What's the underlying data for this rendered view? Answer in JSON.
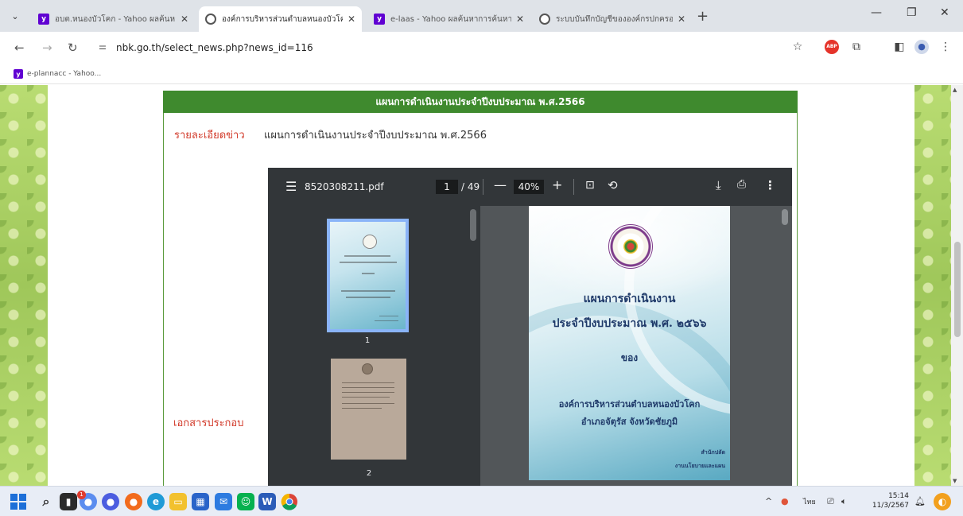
{
  "browser": {
    "tabs": [
      {
        "title": "อบต.หนองบัวโคก - Yahoo ผลค้นหา",
        "favicon": "yahoo-icon",
        "active": false
      },
      {
        "title": "องค์การบริหารส่วนตำบลหนองบัวโคก",
        "favicon": "globe-icon",
        "active": true
      },
      {
        "title": "e-laas - Yahoo ผลค้นหาการค้นหา",
        "favicon": "yahoo-icon",
        "active": false
      },
      {
        "title": "ระบบบันทึกบัญชีขององค์กรปกครอง",
        "favicon": "globe-icon",
        "active": false
      }
    ],
    "close_glyph": "✕",
    "new_tab_glyph": "+",
    "url": "nbk.go.th/select_news.php?news_id=116",
    "bookmark": "e-plannacc - Yahoo...",
    "accent": "#1a73e8"
  },
  "page": {
    "header_title": "แผนการดำเนินงานประจำปีงบประมาณ พ.ศ.2566",
    "detail_label": "รายละเอียดข่าว",
    "detail_value": "แผนการดำเนินงานประจำปีงบประมาณ พ.ศ.2566",
    "attachment_label": "เอกสารประกอบ",
    "header_color": "#3f8a2e",
    "label_color": "#d23b2b"
  },
  "pdf": {
    "filename": "8520308211.pdf",
    "current_page": "1",
    "total_pages": "/ 49",
    "zoom": "40%",
    "thumbnails": [
      {
        "number": "1",
        "selected": true
      },
      {
        "number": "2",
        "selected": false
      }
    ],
    "document": {
      "title_line1": "แผนการดำเนินงาน",
      "title_line2": "ประจำปีงบประมาณ พ.ศ. ๒๕๖๖",
      "of": "ของ",
      "organization": "องค์การบริหารส่วนตำบลหนองบัวโคก",
      "district": "อำเภอจัตุรัส   จังหวัดชัยภูมิ",
      "office": "สำนักปลัด",
      "office_sub": "งานนโยบายและแผน"
    }
  },
  "taskbar": {
    "notification_count": "1",
    "ime": "ไทย",
    "time": "15:14",
    "date": "11/3/2567"
  }
}
